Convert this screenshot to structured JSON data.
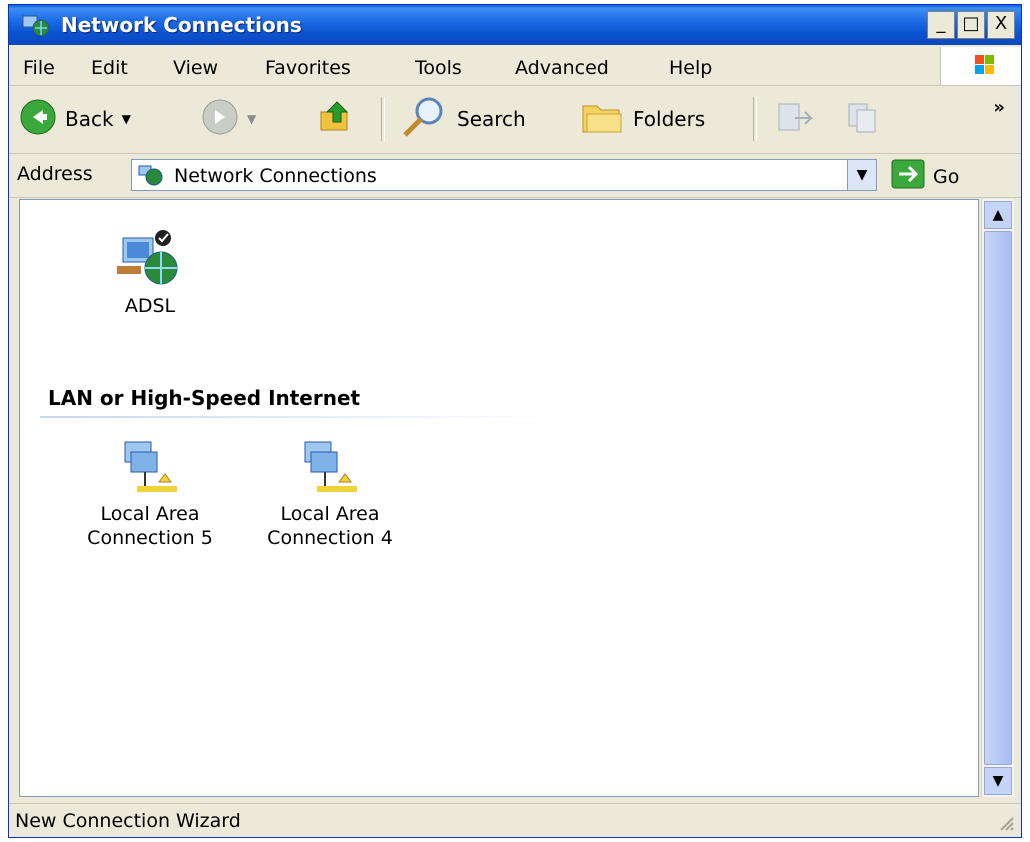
{
  "window": {
    "title": "Network Connections"
  },
  "title_buttons": {
    "minimize": "_",
    "maximize": "□",
    "close": "X"
  },
  "menu": [
    "File",
    "Edit",
    "View",
    "Favorites",
    "Tools",
    "Advanced",
    "Help"
  ],
  "toolbar": {
    "back_label": "Back",
    "search_label": "Search",
    "folders_label": "Folders",
    "overflow": "»"
  },
  "address": {
    "label": "Address",
    "value": "Network Connections",
    "go_label": "Go"
  },
  "connections": {
    "dialup": {
      "name": "ADSL"
    },
    "group_header": "LAN or High-Speed Internet",
    "lan": [
      {
        "line1": "Local Area",
        "line2": "Connection 5"
      },
      {
        "line1": "Local Area",
        "line2": "Connection 4"
      }
    ]
  },
  "status": {
    "text": "New Connection Wizard"
  },
  "colors": {
    "titlebar": "#0a52d2",
    "chrome": "#ece9d8",
    "content_bg": "#ffffff",
    "scrollbar_thumb": "#b7c9f5"
  }
}
